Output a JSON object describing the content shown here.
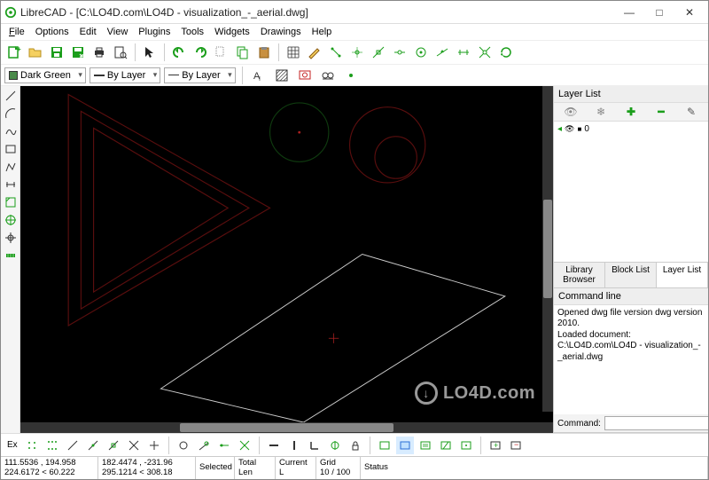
{
  "window": {
    "app_name": "LibreCAD",
    "title_sep": " - ",
    "document_path": "[C:\\LO4D.com\\LO4D - visualization_-_aerial.dwg]"
  },
  "winbuttons": {
    "min": "—",
    "max": "□",
    "close": "✕"
  },
  "menu": {
    "file": "File",
    "options": "Options",
    "edit": "Edit",
    "view": "View",
    "plugins": "Plugins",
    "tools": "Tools",
    "widgets": "Widgets",
    "drawings": "Drawings",
    "help": "Help"
  },
  "toolbar2": {
    "color": "Dark Green",
    "width": "By Layer",
    "linetype": "By Layer"
  },
  "left_tools": [
    "line",
    "arc",
    "curve",
    "rect",
    "poly",
    "dim",
    "hatch",
    "target",
    "crosshair",
    "dims"
  ],
  "layer_panel": {
    "title": "Layer List",
    "icons": {
      "eye": "👁",
      "freeze": "❄",
      "plus": "✚",
      "minus": "━",
      "edit": "✎"
    },
    "row0": {
      "marker": "◂",
      "vis": "👁",
      "frz": "■",
      "name": "0"
    },
    "tabs": {
      "library": "Library Browser",
      "block": "Block List",
      "layer": "Layer List"
    }
  },
  "cmd_panel": {
    "title": "Command line",
    "log_line1": "Opened dwg file version dwg version 2010.",
    "log_line2": "Loaded document: C:\\LO4D.com\\LO4D - visualization_-_aerial.dwg",
    "prompt": "Command:"
  },
  "bottom_tools_label": "Ex",
  "status": {
    "coords1": "111.5536 , 194.958",
    "coords2": "224.6172 < 60.222",
    "dcoords1": "182.4474 , -231.96",
    "dcoords2": "295.1214 < 308.18",
    "selected_h": "Selected",
    "total_h": "Total Len",
    "current_h": "Current L",
    "grid_h": "Grid",
    "grid_v": "10 / 100",
    "status_h": "Status"
  },
  "watermark": {
    "icon": "↓",
    "text": "LO4D.com"
  },
  "icon_colors": {
    "green": "#1b9e1b",
    "black": "#222",
    "red": "#c42020",
    "blue": "#2a6ed6"
  }
}
